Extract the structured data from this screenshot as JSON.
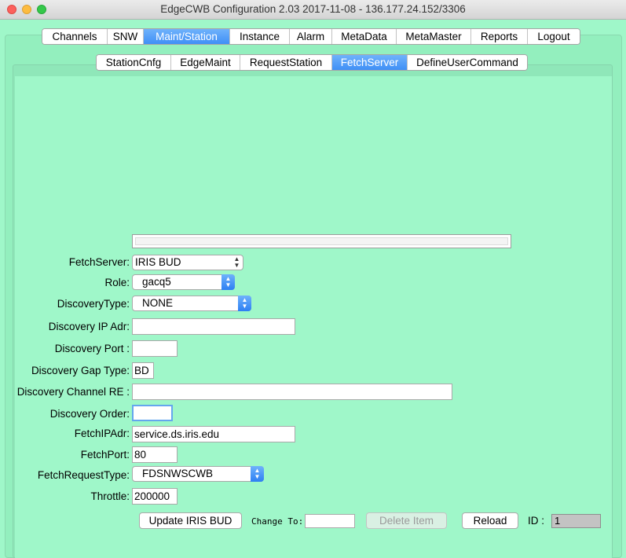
{
  "window": {
    "title": "EdgeCWB Configuration 2.03 2017-11-08 - 136.177.24.152/3306"
  },
  "main_tabs": [
    {
      "label": "Channels",
      "width": 83
    },
    {
      "label": "SNW",
      "width": 46
    },
    {
      "label": "Maint/Station",
      "width": 110,
      "active": true
    },
    {
      "label": "Instance",
      "width": 76
    },
    {
      "label": "Alarm",
      "width": 54
    },
    {
      "label": "MetaData",
      "width": 82
    },
    {
      "label": "MetaMaster",
      "width": 95
    },
    {
      "label": "Reports",
      "width": 72
    },
    {
      "label": "Logout",
      "width": 66
    }
  ],
  "sub_tabs": [
    {
      "label": "StationCnfg",
      "width": 95
    },
    {
      "label": "EdgeMaint",
      "width": 88
    },
    {
      "label": "RequestStation",
      "width": 117
    },
    {
      "label": "FetchServer",
      "width": 96,
      "active": true
    },
    {
      "label": "DefineUserCommand",
      "width": 152
    }
  ],
  "form": {
    "fetch_server_label": "FetchServer:",
    "fetch_server_value": "IRIS BUD",
    "role_label": "Role:",
    "role_value": "gacq5",
    "discovery_type_label": "DiscoveryType:",
    "discovery_type_value": "NONE",
    "discovery_ip_label": "Discovery IP Adr:",
    "discovery_ip_value": "",
    "discovery_port_label": "Discovery Port :",
    "discovery_port_value": "",
    "discovery_gap_type_label": "Discovery Gap Type:",
    "discovery_gap_type_value": "BD",
    "discovery_channel_re_label": "Discovery Channel RE :",
    "discovery_channel_re_value": "",
    "discovery_order_label": "Discovery Order:",
    "discovery_order_value": "",
    "fetch_ip_label": "FetchIPAdr:",
    "fetch_ip_value": "service.ds.iris.edu",
    "fetch_port_label": "FetchPort:",
    "fetch_port_value": "80",
    "fetch_request_type_label": "FetchRequestType:",
    "fetch_request_type_value": "FDSNWSCWB",
    "throttle_label": "Throttle:",
    "throttle_value": "200000"
  },
  "actions": {
    "update_label": "Update IRIS BUD",
    "change_to_label": "Change To:",
    "change_to_value": "",
    "delete_label": "Delete Item",
    "reload_label": "Reload",
    "id_label": "ID :",
    "id_value": "1"
  },
  "colors": {
    "background": "#9ff7c9",
    "tab_active": "#3f8ff6"
  }
}
